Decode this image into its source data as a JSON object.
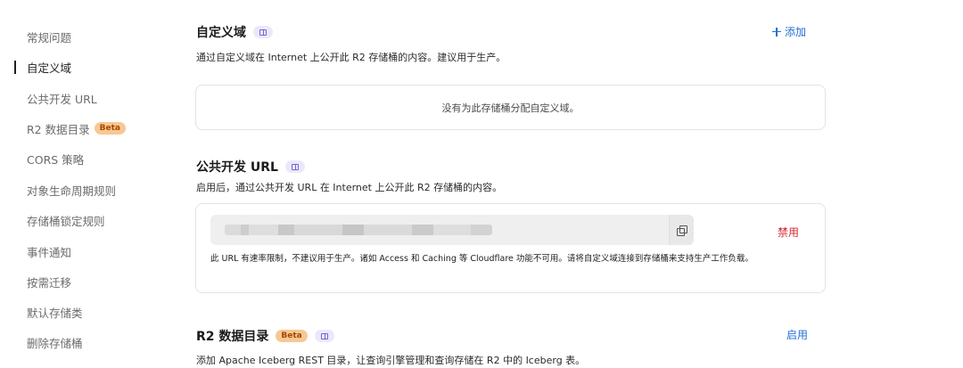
{
  "sidebar": {
    "items": [
      {
        "label": "常规问题"
      },
      {
        "label": "自定义域"
      },
      {
        "label": "公共开发 URL"
      },
      {
        "label": "R2 数据目录",
        "badge": "Beta"
      },
      {
        "label": "CORS 策略"
      },
      {
        "label": "对象生命周期规则"
      },
      {
        "label": "存储桶锁定规则"
      },
      {
        "label": "事件通知"
      },
      {
        "label": "按需迁移"
      },
      {
        "label": "默认存储类"
      },
      {
        "label": "删除存储桶"
      }
    ],
    "active_index": 1
  },
  "custom_domain": {
    "title": "自定义域",
    "description": "通过自定义域在 Internet 上公开此 R2 存储桶的内容。建议用于生产。",
    "add_label": "添加",
    "empty_text": "没有为此存储桶分配自定义域。"
  },
  "public_url": {
    "title": "公共开发 URL",
    "description": "启用后，通过公共开发 URL 在 Internet 上公开此 R2 存储桶的内容。",
    "disable_label": "禁用",
    "note": "此 URL 有速率限制，不建议用于生产。诸如 Access 和 Caching 等 Cloudflare 功能不可用。请将自定义域连接到存储桶来支持生产工作负载。"
  },
  "data_catalog": {
    "title": "R2 数据目录",
    "badge": "Beta",
    "enable_label": "启用",
    "description": "添加 Apache Iceberg REST 目录，让查询引擎管理和查询存储在 R2 中的 Iceberg 表。"
  },
  "colors": {
    "accent": "#1f6fd6",
    "danger": "#d4272e",
    "beta_bg": "#f8c794",
    "icon_bg": "#ece8fb"
  },
  "icons": {
    "doc": "book-icon",
    "copy": "copy-icon",
    "add": "plus-icon"
  }
}
